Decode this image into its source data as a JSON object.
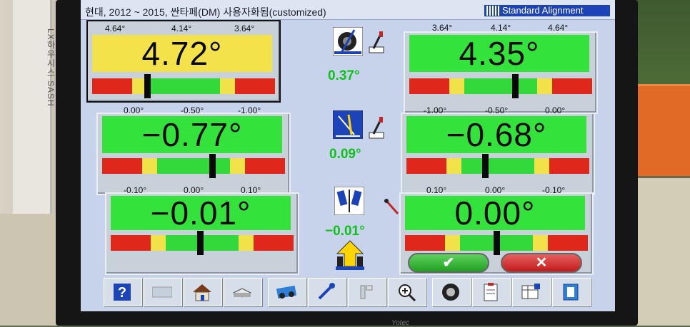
{
  "window": {
    "title": "현대, 2012 ~ 2015, 싼타페(DM) 사용자화됨(customized)",
    "mode_label": "Standard Alignment"
  },
  "wall": {
    "sash_text": "LX하우시스 SASH"
  },
  "panels": [
    {
      "id": "left-camber",
      "scale": [
        "4.64°",
        "4.14°",
        "3.64°"
      ],
      "value": "4.72°",
      "display_color": "#f3e24a",
      "position": 0.3,
      "selected": true
    },
    {
      "id": "right-camber",
      "scale": [
        "3.64°",
        "4.14°",
        "4.64°"
      ],
      "value": "4.35°",
      "display_color": "#33e23a",
      "position": 0.58,
      "selected": false
    },
    {
      "id": "left-caster",
      "scale": [
        "0.00°",
        "-0.50°",
        "-1.00°"
      ],
      "value": "−0.77°",
      "display_color": "#33e23a",
      "position": 0.6,
      "selected": false
    },
    {
      "id": "right-caster",
      "scale": [
        "-1.00°",
        "-0.50°",
        "0.00°"
      ],
      "value": "−0.68°",
      "display_color": "#33e23a",
      "position": 0.43,
      "selected": false
    },
    {
      "id": "left-toe",
      "scale": [
        "-0.10°",
        "0.00°",
        "0.10°"
      ],
      "value": "−0.01°",
      "display_color": "#33e23a",
      "position": 0.49,
      "selected": false
    },
    {
      "id": "right-toe",
      "scale": [
        "0.10°",
        "0.00°",
        "-0.10°"
      ],
      "value": "0.00°",
      "display_color": "#33e23a",
      "position": 0.5,
      "selected": false
    }
  ],
  "cross_values": {
    "camber": "0.37°",
    "caster": "0.09°",
    "toe": "−0.01°"
  },
  "icons": {
    "camber": "wheel-camber-icon",
    "caster": "caster-icon",
    "toe": "toe-icon",
    "adjust_wrench": "wrench-icon",
    "screwdriver": "screwdriver-icon",
    "front_axle": "front-axle-arrow-icon"
  },
  "colors": {
    "bar_red": "#e0271c",
    "bar_yellow": "#f2e24a",
    "bar_green": "#33d83a",
    "value_green": "#12c01c"
  },
  "actions": {
    "ok_mark": "✔",
    "cancel_mark": "✕"
  },
  "toolbar": [
    {
      "name": "help-button",
      "icon": "help-icon"
    },
    {
      "name": "blank-button",
      "icon": "blank-icon"
    },
    {
      "name": "home-button",
      "icon": "home-icon"
    },
    {
      "name": "printer-button",
      "icon": "printer-icon"
    },
    {
      "name": "vehicle-adjust-button",
      "icon": "vehicle-adjust-icon"
    },
    {
      "name": "wrench-button",
      "icon": "wrench-icon"
    },
    {
      "name": "lift-button",
      "icon": "lift-icon"
    },
    {
      "name": "zoom-button",
      "icon": "magnifier-icon"
    },
    {
      "name": "wheel-button",
      "icon": "tire-icon"
    },
    {
      "name": "report-button",
      "icon": "clipboard-icon"
    },
    {
      "name": "spec-table-button",
      "icon": "spec-table-icon"
    },
    {
      "name": "exit-button",
      "icon": "exit-icon"
    }
  ]
}
